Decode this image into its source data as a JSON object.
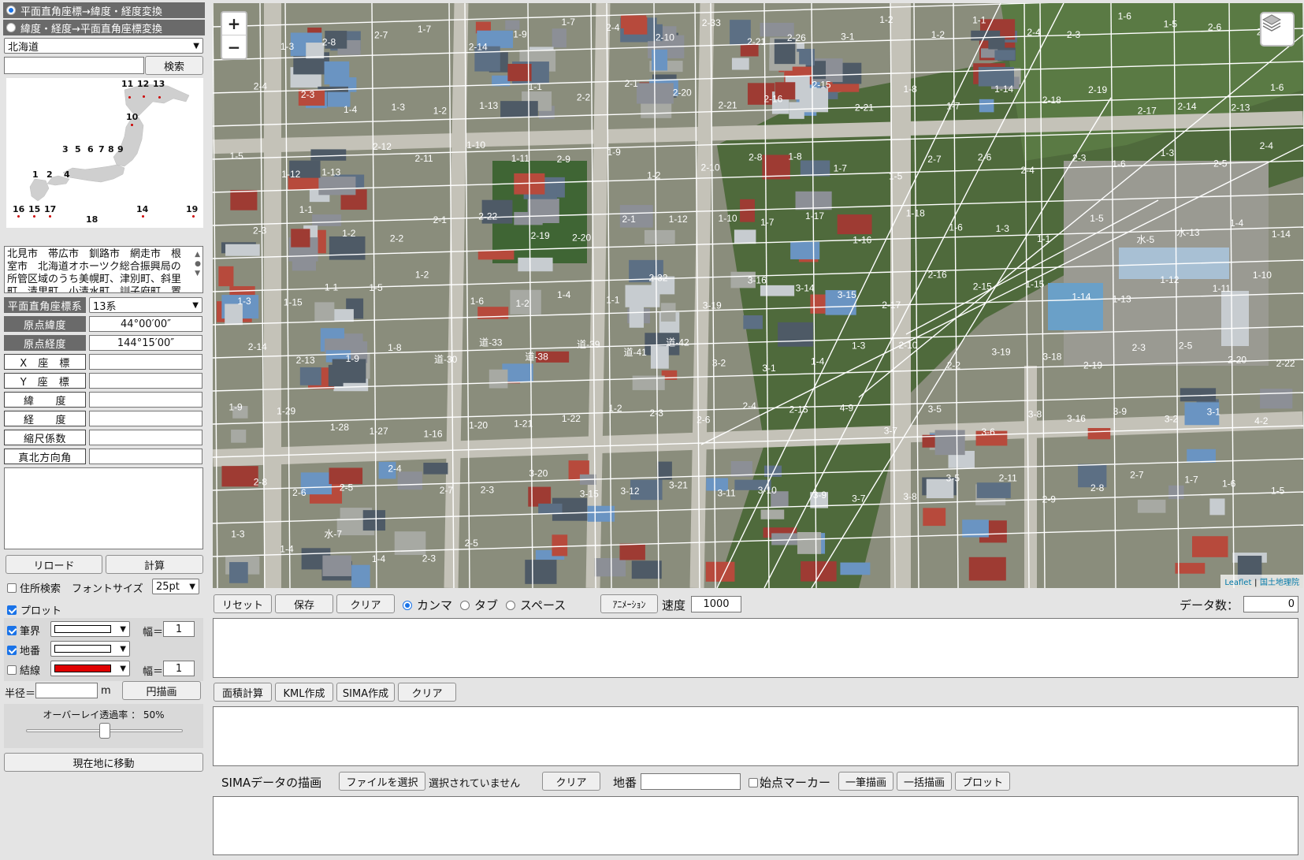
{
  "left": {
    "mode_1": "平面直角座標→緯度・経度変換",
    "mode_2": "緯度・経度→平面直角座標変換",
    "region": "北海道",
    "search_button": "検索",
    "japan_zones": [
      "1",
      "2",
      "3",
      "4",
      "5",
      "6",
      "7",
      "8",
      "9",
      "10",
      "11",
      "12",
      "13",
      "14",
      "15",
      "16",
      "17",
      "18",
      "19"
    ],
    "zone_description": "北見市　帯広市　釧路市　網走市　根室市　北海道オホーツク総合振興局の所管区域のうち美幌町、津別町、斜里町、清里町、小清水町、訓子府町、置",
    "fields": {
      "system_label": "平面直角座標系",
      "system_value": "13系",
      "origin_lat_label": "原点緯度",
      "origin_lat_value": "44°00′00″",
      "origin_lon_label": "原点経度",
      "origin_lon_value": "144°15′00″",
      "x_label": "X　座　標",
      "y_label": "Y　座　標",
      "lat_label": "緯　　度",
      "lon_label": "経　　度",
      "scale_label": "縮尺係数",
      "north_label": "真北方向角"
    },
    "reload_button": "リロード",
    "calc_button": "計算",
    "address_search_label": "住所検索",
    "font_size_label": "フォントサイズ",
    "font_size_value": "25pt",
    "plot_label": "プロット",
    "layers": [
      {
        "label": "筆界",
        "checked": true,
        "color": "#ffffff",
        "width_label": "幅＝",
        "width": "1"
      },
      {
        "label": "地番",
        "checked": true,
        "color": "#ffffff"
      },
      {
        "label": "結線",
        "checked": false,
        "color": "#e00000",
        "width_label": "幅＝",
        "width": "1"
      }
    ],
    "radius_label": "半径＝",
    "radius_unit": "m",
    "circle_button": "円描画",
    "overlay_label": "オーバーレイ透過率 ： 50%",
    "overlay_value": 0.5,
    "locate_button": "現在地に移動"
  },
  "map": {
    "zoom_in": "+",
    "zoom_out": "−",
    "attribution_leaflet": "Leaflet",
    "attribution_sep": " | ",
    "attribution_gsi": "国土地理院",
    "lot_labels": [
      "1-4",
      "1-3",
      "2-8",
      "2-7",
      "1-7",
      "2-14",
      "1-9",
      "1-7",
      "2-4",
      "2-10",
      "2-33",
      "2-21",
      "2-26",
      "3-1",
      "1-2",
      "1-2",
      "1-1",
      "2-4",
      "2-3",
      "1-6",
      "1-5",
      "2-6",
      "2-5",
      "2-4",
      "2-3",
      "1-4",
      "1-3",
      "1-2",
      "1-13",
      "1-1",
      "2-2",
      "2-1",
      "2-20",
      "2-21",
      "2-16",
      "2-15",
      "2-21",
      "1-8",
      "1-7",
      "1-14",
      "2-18",
      "2-19",
      "2-17",
      "2-14",
      "2-13",
      "1-6",
      "1-5",
      "1-12",
      "1-13",
      "2-12",
      "2-11",
      "1-10",
      "1-11",
      "2-9",
      "1-9",
      "1-2",
      "2-10",
      "2-8",
      "1-8",
      "1-7",
      "1-5",
      "2-7",
      "2-6",
      "2-4",
      "2-3",
      "1-6",
      "1-3",
      "2-5",
      "2-4",
      "2-3",
      "1-1",
      "1-2",
      "2-2",
      "2-1",
      "2-22",
      "2-19",
      "2-20",
      "2-1",
      "1-12",
      "1-10",
      "1-7",
      "1-17",
      "1-16",
      "1-18",
      "1-6",
      "1-3",
      "1-1",
      "1-5",
      "水-5",
      "水-13",
      "1-4",
      "1-14",
      "1-3",
      "1-15",
      "1-1",
      "1-5",
      "1-2",
      "1-6",
      "1-2",
      "1-4",
      "1-1",
      "2-32",
      "3-19",
      "3-16",
      "3-14",
      "3-15",
      "2-17",
      "2-16",
      "2-15",
      "1-15",
      "1-14",
      "1-13",
      "1-12",
      "1-11",
      "1-10",
      "2-14",
      "2-13",
      "1-9",
      "1-8",
      "道-30",
      "道-33",
      "道-38",
      "道-39",
      "道-41",
      "道-42",
      "3-2",
      "3-1",
      "1-4",
      "1-3",
      "2-10",
      "2-2",
      "3-19",
      "3-18",
      "2-19",
      "2-3",
      "2-5",
      "2-20",
      "2-22",
      "1-9",
      "1-29",
      "1-28",
      "1-27",
      "1-16",
      "1-20",
      "1-21",
      "1-22",
      "1-2",
      "2-3",
      "2-6",
      "2-4",
      "2-15",
      "4-9",
      "3-7",
      "3-5",
      "3-6",
      "3-8",
      "3-16",
      "3-9",
      "3-2",
      "3-1",
      "4-2",
      "2-8",
      "2-6",
      "2-5",
      "2-4",
      "2-7",
      "2-3",
      "3-20",
      "3-15",
      "3-12",
      "3-21",
      "3-11",
      "3-10",
      "3-9",
      "3-7",
      "3-8",
      "3-5",
      "2-11",
      "2-9",
      "2-8",
      "2-7",
      "1-7",
      "1-6",
      "1-5",
      "1-3",
      "1-4",
      "水-7",
      "1-4",
      "2-3",
      "2-5"
    ]
  },
  "bottom": {
    "reset_button": "リセット",
    "save_button": "保存",
    "clear_button": "クリア",
    "delim_comma": "カンマ",
    "delim_tab": "タブ",
    "delim_space": "スペース",
    "animation_button": "ｱﾆﾒｰｼｮﾝ",
    "speed_label": "速度",
    "speed_value": "1000",
    "data_count_label": "データ数：",
    "data_count_value": "0",
    "area_button": "面積計算",
    "kml_button": "KML作成",
    "sima_button": "SIMA作成",
    "clear2_button": "クリア",
    "sima_draw_label": "SIMAデータの描画",
    "file_button": "ファイルを選択",
    "file_status": "選択されていません",
    "clear3_button": "クリア",
    "lot_label": "地番",
    "start_marker_label": "始点マーカー",
    "single_draw_button": "一筆描画",
    "batch_draw_button": "一括描画",
    "plot_button": "プロット"
  }
}
